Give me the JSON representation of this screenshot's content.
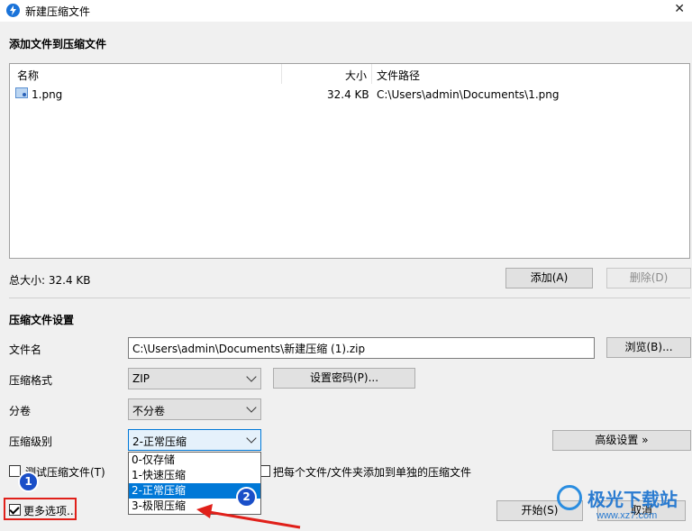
{
  "window": {
    "title": "新建压缩文件"
  },
  "add_section": {
    "title": "添加文件到压缩文件",
    "columns": [
      "名称",
      "大小",
      "文件路径"
    ],
    "files": [
      {
        "name": "1.png",
        "size": "32.4 KB",
        "path": "C:\\Users\\admin\\Documents\\1.png"
      }
    ],
    "total_size": "总大小: 32.4 KB",
    "add_button": "添加(A)",
    "delete_button": "删除(D)"
  },
  "settings": {
    "title": "压缩文件设置",
    "filename_label": "文件名",
    "filename_value": "C:\\Users\\admin\\Documents\\新建压缩 (1).zip",
    "browse_button": "浏览(B)...",
    "format_label": "压缩格式",
    "format_value": "ZIP",
    "password_button": "设置密码(P)...",
    "split_label": "分卷",
    "split_value": "不分卷",
    "level_label": "压缩级别",
    "level_value": "2-正常压缩",
    "advanced_button": "高级设置 »",
    "level_options": [
      "0-仅存储",
      "1-快速压缩",
      "2-正常压缩",
      "3-极限压缩"
    ],
    "selected_level_index": 2,
    "test_checkbox_label": "测试压缩文件(T)",
    "separate_checkbox_label": "把每个文件/文件夹添加到单独的压缩文件",
    "more_options_label": "更多选项...",
    "more_options_checked": true
  },
  "footer": {
    "start_button": "开始(S)",
    "cancel_button": "取消"
  },
  "annotations": {
    "badge_1": "1",
    "badge_2": "2",
    "highlight_color": "#e0201a",
    "badge_color": "#1a4fc8"
  },
  "watermark": {
    "text": "极光下载站",
    "url": "www.xz7.com"
  },
  "colors": {
    "accent": "#0078d7",
    "window_bg": "#f0f0f0"
  }
}
